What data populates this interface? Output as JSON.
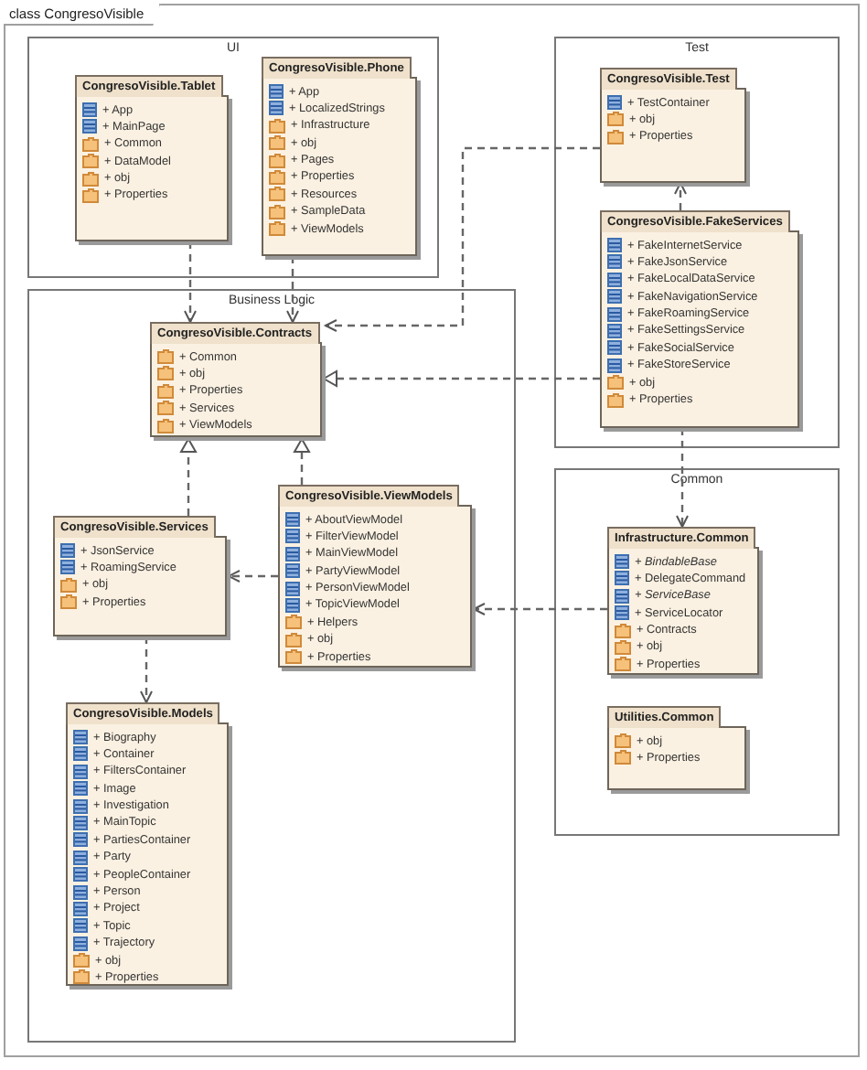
{
  "diagram": {
    "title": "class CongresoVisible",
    "regions": [
      {
        "label": "UI",
        "packages": [
          {
            "name": "CongresoVisible.Tablet",
            "items": [
              {
                "kind": "class",
                "label": "+ App"
              },
              {
                "kind": "class",
                "label": "+ MainPage"
              },
              {
                "kind": "package",
                "label": "+ Common"
              },
              {
                "kind": "package",
                "label": "+ DataModel"
              },
              {
                "kind": "package",
                "label": "+ obj"
              },
              {
                "kind": "package",
                "label": "+ Properties"
              }
            ]
          },
          {
            "name": "CongresoVisible.Phone",
            "items": [
              {
                "kind": "class",
                "label": "+ App"
              },
              {
                "kind": "class",
                "label": "+ LocalizedStrings"
              },
              {
                "kind": "package",
                "label": "+ Infrastructure"
              },
              {
                "kind": "package",
                "label": "+ obj"
              },
              {
                "kind": "package",
                "label": "+ Pages"
              },
              {
                "kind": "package",
                "label": "+ Properties"
              },
              {
                "kind": "package",
                "label": "+ Resources"
              },
              {
                "kind": "package",
                "label": "+ SampleData"
              },
              {
                "kind": "package",
                "label": "+ ViewModels"
              }
            ]
          }
        ]
      },
      {
        "label": "Test",
        "packages": [
          {
            "name": "CongresoVisible.Test",
            "items": [
              {
                "kind": "class",
                "label": "+ TestContainer"
              },
              {
                "kind": "package",
                "label": "+ obj"
              },
              {
                "kind": "package",
                "label": "+ Properties"
              }
            ]
          },
          {
            "name": "CongresoVisible.FakeServices",
            "items": [
              {
                "kind": "class",
                "label": "+ FakeInternetService"
              },
              {
                "kind": "class",
                "label": "+ FakeJsonService"
              },
              {
                "kind": "class",
                "label": "+ FakeLocalDataService"
              },
              {
                "kind": "class",
                "label": "+ FakeNavigationService"
              },
              {
                "kind": "class",
                "label": "+ FakeRoamingService"
              },
              {
                "kind": "class",
                "label": "+ FakeSettingsService"
              },
              {
                "kind": "class",
                "label": "+ FakeSocialService"
              },
              {
                "kind": "class",
                "label": "+ FakeStoreService"
              },
              {
                "kind": "package",
                "label": "+ obj"
              },
              {
                "kind": "package",
                "label": "+ Properties"
              }
            ]
          }
        ]
      },
      {
        "label": "Business Logic",
        "packages": [
          {
            "name": "CongresoVisible.Contracts",
            "items": [
              {
                "kind": "package",
                "label": "+ Common"
              },
              {
                "kind": "package",
                "label": "+ obj"
              },
              {
                "kind": "package",
                "label": "+ Properties"
              },
              {
                "kind": "package",
                "label": "+ Services"
              },
              {
                "kind": "package",
                "label": "+ ViewModels"
              }
            ]
          },
          {
            "name": "CongresoVisible.Services",
            "items": [
              {
                "kind": "class",
                "label": "+ JsonService"
              },
              {
                "kind": "class",
                "label": "+ RoamingService"
              },
              {
                "kind": "package",
                "label": "+ obj"
              },
              {
                "kind": "package",
                "label": "+ Properties"
              }
            ]
          },
          {
            "name": "CongresoVisible.ViewModels",
            "items": [
              {
                "kind": "class",
                "label": "+ AboutViewModel"
              },
              {
                "kind": "class",
                "label": "+ FilterViewModel"
              },
              {
                "kind": "class",
                "label": "+ MainViewModel"
              },
              {
                "kind": "class",
                "label": "+ PartyViewModel"
              },
              {
                "kind": "class",
                "label": "+ PersonViewModel"
              },
              {
                "kind": "class",
                "label": "+ TopicViewModel"
              },
              {
                "kind": "package",
                "label": "+ Helpers"
              },
              {
                "kind": "package",
                "label": "+ obj"
              },
              {
                "kind": "package",
                "label": "+ Properties"
              }
            ]
          },
          {
            "name": "CongresoVisible.Models",
            "items": [
              {
                "kind": "class",
                "label": "+ Biography"
              },
              {
                "kind": "class",
                "label": "+ Container"
              },
              {
                "kind": "class",
                "label": "+ FiltersContainer"
              },
              {
                "kind": "class",
                "label": "+ Image"
              },
              {
                "kind": "class",
                "label": "+ Investigation"
              },
              {
                "kind": "class",
                "label": "+ MainTopic"
              },
              {
                "kind": "class",
                "label": "+ PartiesContainer"
              },
              {
                "kind": "class",
                "label": "+ Party"
              },
              {
                "kind": "class",
                "label": "+ PeopleContainer"
              },
              {
                "kind": "class",
                "label": "+ Person"
              },
              {
                "kind": "class",
                "label": "+ Project"
              },
              {
                "kind": "class",
                "label": "+ Topic"
              },
              {
                "kind": "class",
                "label": "+ Trajectory"
              },
              {
                "kind": "package",
                "label": "+ obj"
              },
              {
                "kind": "package",
                "label": "+ Properties"
              }
            ]
          }
        ]
      },
      {
        "label": "Common",
        "packages": [
          {
            "name": "Infrastructure.Common",
            "items": [
              {
                "kind": "class",
                "label": "+ BindableBase",
                "abstract": true
              },
              {
                "kind": "class",
                "label": "+ DelegateCommand",
                "abstract": false
              },
              {
                "kind": "class",
                "label": "+ ServiceBase",
                "abstract": true
              },
              {
                "kind": "class",
                "label": "+ ServiceLocator",
                "abstract": false
              },
              {
                "kind": "package",
                "label": "+ Contracts",
                "abstract": false
              },
              {
                "kind": "package",
                "label": "+ obj",
                "abstract": false
              },
              {
                "kind": "package",
                "label": "+ Properties",
                "abstract": false
              }
            ]
          },
          {
            "name": "Utilities.Common",
            "items": [
              {
                "kind": "package",
                "label": "+ obj"
              },
              {
                "kind": "package",
                "label": "+ Properties"
              }
            ]
          }
        ]
      }
    ]
  }
}
